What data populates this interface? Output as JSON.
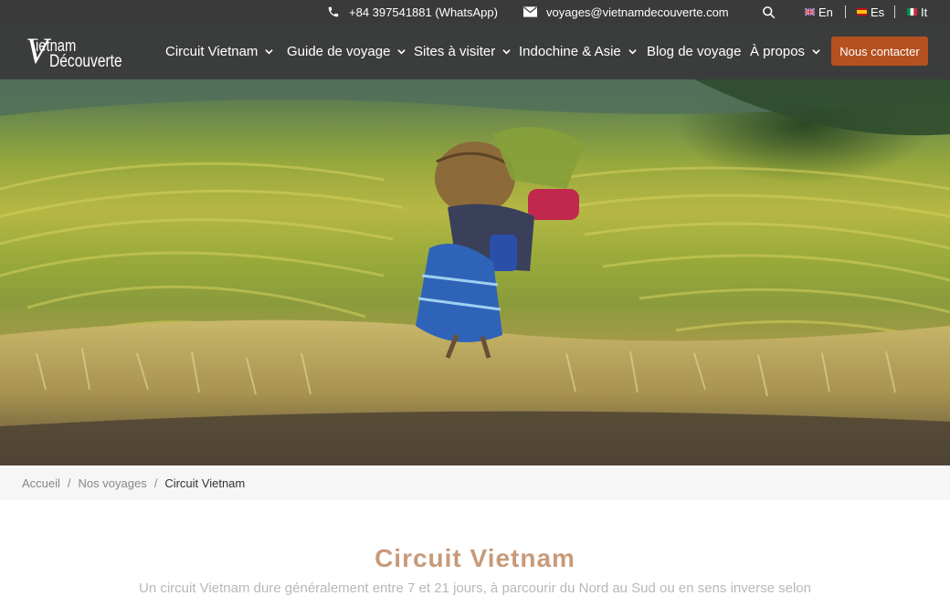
{
  "topbar": {
    "phone": "+84 397541881 (WhatsApp)",
    "email": "voyages@vietnamdecouverte.com",
    "languages": [
      {
        "code": "En",
        "flag": "uk-flag-icon"
      },
      {
        "code": "Es",
        "flag": "spain-flag-icon"
      },
      {
        "code": "It",
        "flag": "italy-flag-icon"
      }
    ]
  },
  "logo": {
    "line1": "V",
    "line2": "ietnam",
    "line3": "Découverte"
  },
  "nav": {
    "items": [
      {
        "label": "Circuit Vietnam",
        "dropdown": true
      },
      {
        "label": "Guide de voyage",
        "dropdown": true
      },
      {
        "label": "Sites à visiter",
        "dropdown": true
      },
      {
        "label": "Indochine & Asie",
        "dropdown": true
      },
      {
        "label": "Blog de voyage",
        "dropdown": false
      },
      {
        "label": "À propos",
        "dropdown": true
      }
    ],
    "cta": "Nous contacter"
  },
  "breadcrumb": {
    "items": [
      "Accueil",
      "Nos voyages"
    ],
    "current": "Circuit Vietnam",
    "separator": "/"
  },
  "page": {
    "title": "Circuit Vietnam",
    "lead": "Un circuit Vietnam dure généralement entre 7 et 21 jours, à parcourir du Nord au Sud ou en sens inverse selon"
  },
  "colors": {
    "accent": "#b5501f",
    "title": "#c79a7a",
    "nav_bg": "#3b3d3c",
    "topbar_bg": "#3a3a3a"
  }
}
